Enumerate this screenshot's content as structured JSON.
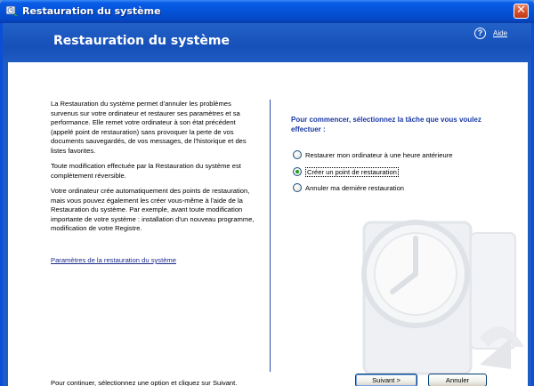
{
  "window": {
    "title": "Restauration du système",
    "close_symbol": "✕"
  },
  "header": {
    "title": "Restauration du système",
    "help_label": "Aide",
    "help_symbol": "?"
  },
  "left": {
    "paragraphs": [
      "La Restauration du système permet d'annuler les problèmes survenus sur votre ordinateur et restaurer ses paramètres et sa performance. Elle remet votre ordinateur à son état précédent (appelé point de restauration) sans provoquer la perte de vos documents sauvegardés, de vos messages, de l'historique et des listes favorites.",
      "Toute modification effectuée par la Restauration du système est complètement réversible.",
      "Votre ordinateur crée automatiquement des points de restauration, mais vous pouvez également les créer vous-même à l'aide de la Restauration du système. Par exemple, avant toute modification importante de votre système : installation d'un nouveau programme, modification de votre Registre."
    ],
    "settings_link": "Paramètres de la restauration du système"
  },
  "right": {
    "prompt": "Pour commencer, sélectionnez la tâche que vous voulez effectuer :",
    "options": [
      {
        "label": "Restaurer mon ordinateur à une heure antérieure",
        "checked": false
      },
      {
        "label": "Créer un point de restauration",
        "checked": true
      },
      {
        "label": "Annuler ma dernière restauration",
        "checked": false
      }
    ]
  },
  "footer": {
    "instruction": "Pour continuer, sélectionnez une option et cliquez sur Suivant.",
    "next_label": "Suivant >",
    "cancel_label": "Annuler"
  },
  "colors": {
    "title_bar": "#0452d6",
    "header_band": "#1650b8",
    "prompt_text": "#1a3aa4",
    "link": "#1c2a8c"
  }
}
